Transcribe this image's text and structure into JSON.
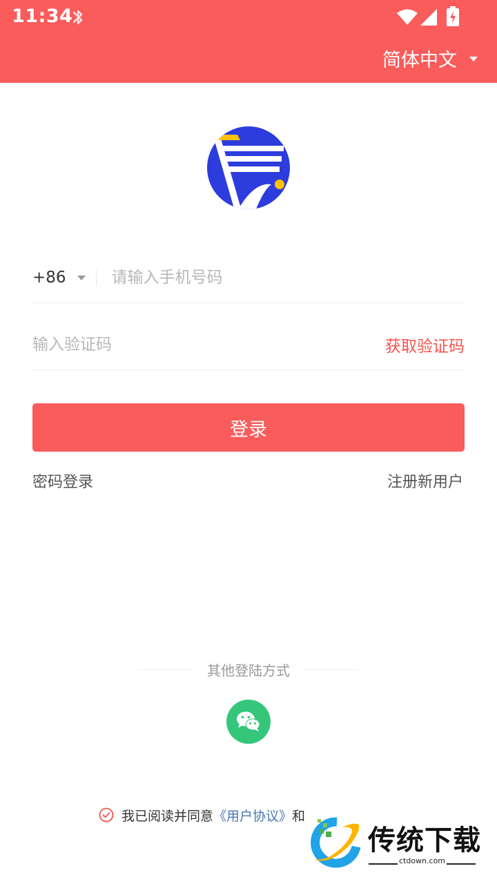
{
  "status_bar": {
    "time": "11:34",
    "icons": [
      "bluetooth-icon",
      "wifi-icon",
      "signal-icon",
      "battery-charging-icon"
    ]
  },
  "header": {
    "language": "简体中文",
    "language_icon": "caret-down-icon",
    "background_color": "#f95c5b"
  },
  "logo": {
    "icon": "app-logo-icon",
    "colors": [
      "#2f3ee0",
      "#ffc107"
    ]
  },
  "form": {
    "country_code": "+86",
    "phone_placeholder": "请输入手机号码",
    "phone_value": "",
    "code_placeholder": "输入验证码",
    "code_value": "",
    "get_code_label": "获取验证码",
    "login_label": "登录"
  },
  "links": {
    "password_login": "密码登录",
    "register": "注册新用户"
  },
  "other_login": {
    "label": "其他登陆方式",
    "methods": [
      "wechat-icon"
    ],
    "wechat_color": "#35c67b"
  },
  "agreement": {
    "prefix": "我已阅读并同意",
    "link": "《用户协议》",
    "suffix": "和",
    "checked": true
  },
  "watermark": {
    "title": "传统下载",
    "subtitle": "ctdown.com"
  }
}
